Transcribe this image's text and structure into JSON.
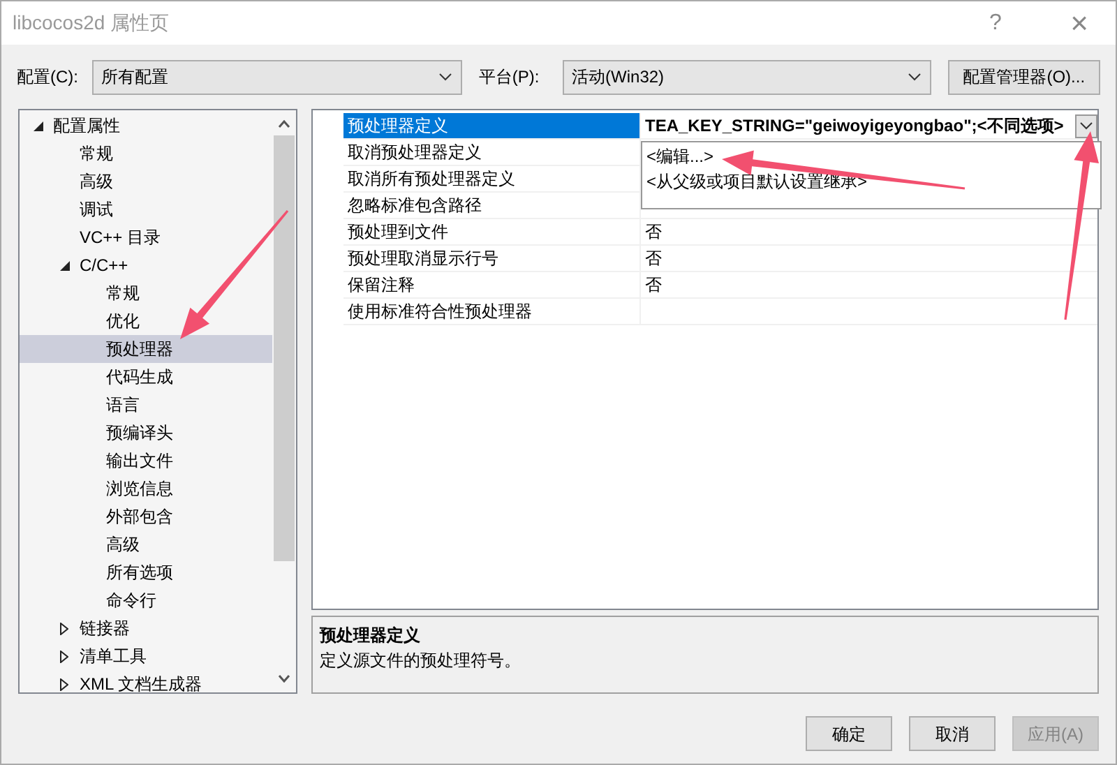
{
  "window": {
    "title": "libcocos2d 属性页",
    "help": "?",
    "close": "×"
  },
  "config": {
    "label": "配置(C):",
    "value": "所有配置"
  },
  "platform": {
    "label": "平台(P):",
    "value": "活动(Win32)"
  },
  "config_manager": "配置管理器(O)...",
  "tree": [
    {
      "label": "配置属性",
      "expanded": true,
      "selected": false,
      "children": [
        {
          "label": "常规",
          "selected": false
        },
        {
          "label": "高级",
          "selected": false
        },
        {
          "label": "调试",
          "selected": false
        },
        {
          "label": "VC++ 目录",
          "selected": false
        },
        {
          "label": "C/C++",
          "expanded": true,
          "selected": false,
          "children": [
            {
              "label": "常规",
              "selected": false
            },
            {
              "label": "优化",
              "selected": false
            },
            {
              "label": "预处理器",
              "selected": true
            },
            {
              "label": "代码生成",
              "selected": false
            },
            {
              "label": "语言",
              "selected": false
            },
            {
              "label": "预编译头",
              "selected": false
            },
            {
              "label": "输出文件",
              "selected": false
            },
            {
              "label": "浏览信息",
              "selected": false
            },
            {
              "label": "外部包含",
              "selected": false
            },
            {
              "label": "高级",
              "selected": false
            },
            {
              "label": "所有选项",
              "selected": false
            },
            {
              "label": "命令行",
              "selected": false
            }
          ]
        },
        {
          "label": "链接器",
          "expanded": false,
          "selected": false
        },
        {
          "label": "清单工具",
          "expanded": false,
          "selected": false
        },
        {
          "label": "XML 文档生成器",
          "expanded": false,
          "selected": false
        }
      ]
    }
  ],
  "properties": [
    {
      "name": "预处理器定义",
      "value": "TEA_KEY_STRING=\"geiwoyigeyongbao\";<不同选项>",
      "selected": true
    },
    {
      "name": "取消预处理器定义",
      "selected": false
    },
    {
      "name": "取消所有预处理器定义",
      "selected": false
    },
    {
      "name": "忽略标准包含路径",
      "selected": false
    },
    {
      "name": "预处理到文件",
      "value": "否",
      "selected": false
    },
    {
      "name": "预处理取消显示行号",
      "value": "否",
      "selected": false
    },
    {
      "name": "保留注释",
      "value": "否",
      "selected": false
    },
    {
      "name": "使用标准符合性预处理器",
      "selected": false
    }
  ],
  "dropdown_options": [
    "<编辑...>",
    "<从父级或项目默认设置继承>"
  ],
  "description": {
    "title": "预处理器定义",
    "text": "定义源文件的预处理符号。"
  },
  "buttons": [
    {
      "label": "确定",
      "disabled": false
    },
    {
      "label": "取消",
      "disabled": false
    },
    {
      "label": "应用(A)",
      "disabled": true
    }
  ]
}
